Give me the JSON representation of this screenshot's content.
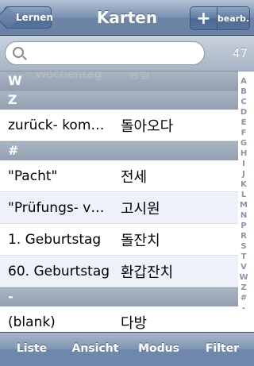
{
  "navbar": {
    "back_label": "Lernen",
    "title": "Karten",
    "plus_label": "+",
    "edit_label": "bearb."
  },
  "search": {
    "placeholder": "",
    "count": "47"
  },
  "list": {
    "ghost": {
      "de": "Wochentag",
      "ko": "평일"
    },
    "sections": [
      {
        "header": "W",
        "rows": []
      },
      {
        "header": "Z",
        "rows": [
          {
            "de": "zurück- kom…",
            "ko": "돌아오다"
          }
        ]
      },
      {
        "header": "#",
        "rows": [
          {
            "de": "\"Pacht\"",
            "ko": "전세"
          },
          {
            "de": "\"Prüfungs- v…",
            "ko": "고시원"
          },
          {
            "de": "1. Geburtstag",
            "ko": "돌잔치"
          },
          {
            "de": "60. Geburtstag",
            "ko": "환갑잔치"
          }
        ]
      },
      {
        "header": "-",
        "rows": [
          {
            "de": "(blank)",
            "ko": "다방"
          }
        ]
      }
    ]
  },
  "index": [
    "A",
    "B",
    "C",
    "D",
    "E",
    "F",
    "G",
    "H",
    "I",
    "J",
    "K",
    "L",
    "M",
    "N",
    "P",
    "R",
    "S",
    "T",
    "V",
    "W",
    "Z",
    "#",
    "-"
  ],
  "toolbar": {
    "items": [
      "Liste",
      "Ansicht",
      "Modus",
      "Filter"
    ]
  }
}
